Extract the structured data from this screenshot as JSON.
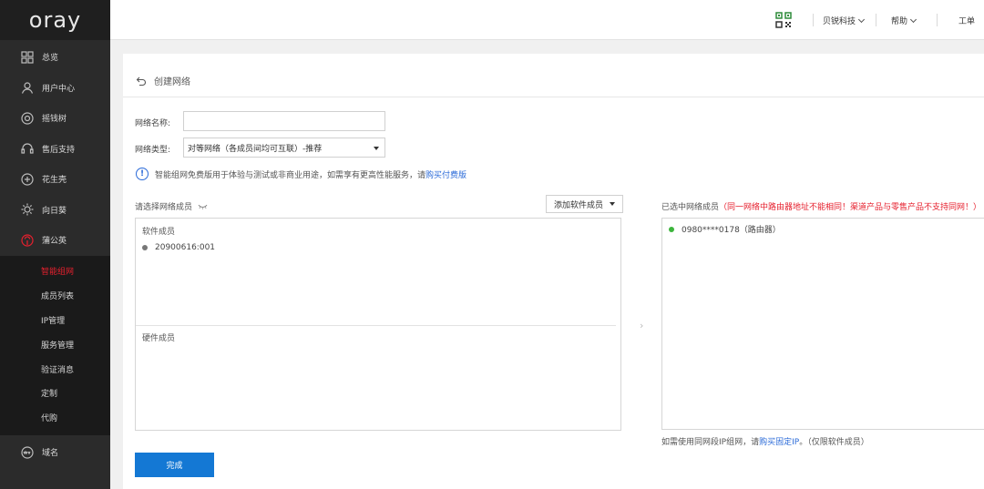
{
  "app": {
    "logo_text": "oray"
  },
  "sidebar": {
    "items": [
      {
        "label": "总览",
        "icon": "grid-icon"
      },
      {
        "label": "用户中心",
        "icon": "user-icon"
      },
      {
        "label": "摇钱树",
        "icon": "target-icon"
      },
      {
        "label": "售后支持",
        "icon": "headset-icon"
      },
      {
        "label": "花生壳",
        "icon": "peanut-icon"
      },
      {
        "label": "向日葵",
        "icon": "sunflower-icon"
      },
      {
        "label": "蒲公英",
        "icon": "dandelion-icon"
      }
    ],
    "subitems": [
      {
        "label": "智能组网",
        "active": true
      },
      {
        "label": "成员列表"
      },
      {
        "label": "IP管理"
      },
      {
        "label": "服务管理"
      },
      {
        "label": "验证消息"
      },
      {
        "label": "定制"
      },
      {
        "label": "代购"
      }
    ],
    "bottom_item": {
      "label": "域名",
      "icon": "www-icon"
    },
    "accent_color": "#e6202e"
  },
  "topbar": {
    "company": "贝锐科技",
    "help": "帮助",
    "ticket": "工单"
  },
  "page": {
    "title": "创建网络",
    "network_name_label": "网络名称:",
    "network_name_value": "",
    "network_type_label": "网络类型:",
    "network_type_value": "对等网络（各成员间均可互联）-推荐",
    "notice_text": "智能组网免费版用于体验与测试或非商业用途，如需享有更高性能服务，请",
    "notice_link": "购买付费版",
    "select_members_label": "请选择网络成员",
    "add_software_member": "添加软件成员",
    "software_members_title": "软件成员",
    "software_members": [
      "20900616:001"
    ],
    "hardware_members_title": "硬件成员",
    "selected_members_label": "已选中网络成员",
    "selected_members_warning": "（同一网络中路由器地址不能相同！渠道产品与零售产品不支持同网！）",
    "selected_members": [
      "0980****0178（路由器）"
    ],
    "fixed_ip_prefix": "如需使用同网段IP组网，请",
    "fixed_ip_link": "购买固定IP",
    "fixed_ip_suffix": "。（仅限软件成员）",
    "finish_button": "完成",
    "primary_color": "#1478d4"
  }
}
